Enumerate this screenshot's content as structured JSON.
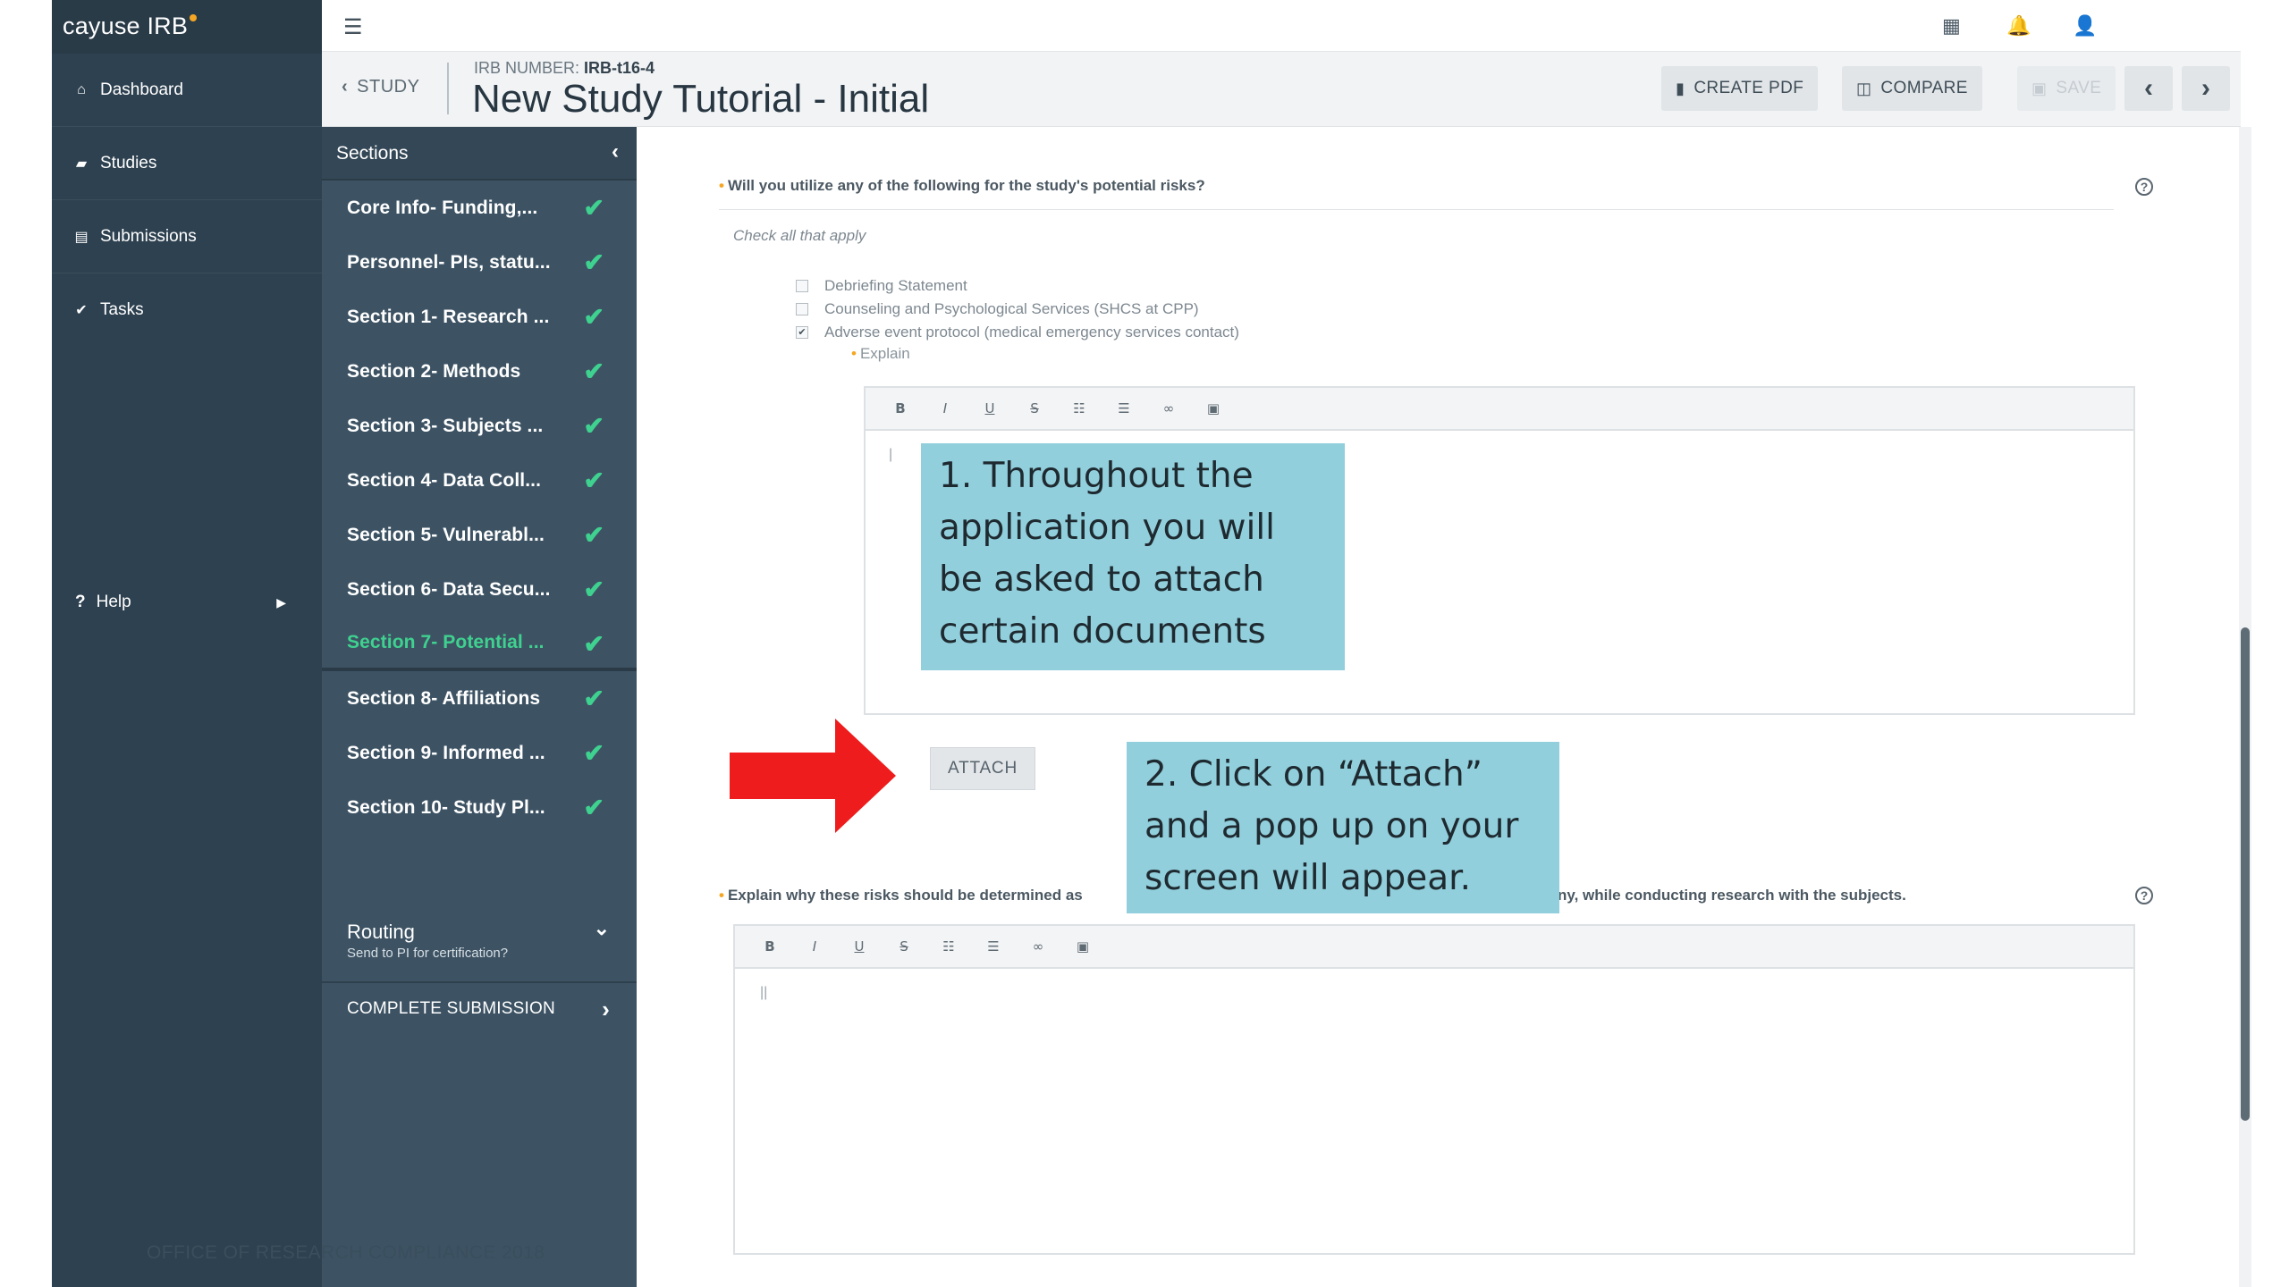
{
  "app": {
    "brand": "cayuse IRB"
  },
  "leftnav": {
    "items": [
      {
        "label": "Dashboard",
        "icon": "home-icon"
      },
      {
        "label": "Studies",
        "icon": "folder-icon"
      },
      {
        "label": "Submissions",
        "icon": "document-icon"
      },
      {
        "label": "Tasks",
        "icon": "check-icon"
      }
    ],
    "help": "Help"
  },
  "header": {
    "back_label": "STUDY",
    "irb_label": "IRB NUMBER:",
    "irb_number": "IRB-t16-4",
    "title": "New Study Tutorial - Initial",
    "buttons": {
      "create_pdf": "CREATE PDF",
      "compare": "COMPARE",
      "save": "SAVE"
    }
  },
  "sections": {
    "header": "Sections",
    "items": [
      {
        "label": "Core Info- Funding,...",
        "complete": true
      },
      {
        "label": "Personnel- PIs, statu...",
        "complete": true
      },
      {
        "label": "Section 1- Research ...",
        "complete": true
      },
      {
        "label": "Section 2- Methods",
        "complete": true
      },
      {
        "label": "Section 3- Subjects ...",
        "complete": true
      },
      {
        "label": "Section 4- Data Coll...",
        "complete": true
      },
      {
        "label": "Section 5- Vulnerabl...",
        "complete": true
      },
      {
        "label": "Section 6- Data Secu...",
        "complete": true
      },
      {
        "label": "Section 7- Potential ...",
        "complete": true,
        "active": true
      },
      {
        "label": "Section 8- Affiliations",
        "complete": true
      },
      {
        "label": "Section 9- Informed ...",
        "complete": true
      },
      {
        "label": "Section 10- Study Pl...",
        "complete": true
      }
    ],
    "routing_title": "Routing",
    "routing_sub": "Send to PI for certification?",
    "complete_submission": "COMPLETE SUBMISSION"
  },
  "main": {
    "question1": "Will you utilize any of the following for the study's potential risks?",
    "check_all": "Check all that apply",
    "options": [
      {
        "label": "Debriefing Statement",
        "checked": false
      },
      {
        "label": "Counseling and Psychological Services (SHCS at CPP)",
        "checked": false
      },
      {
        "label": "Adverse event protocol (medical emergency services contact)",
        "checked": true
      }
    ],
    "explain_label": "Explain",
    "toolbar": [
      "B",
      "I",
      "U",
      "S",
      "list-ordered",
      "list-bulleted",
      "link",
      "image"
    ],
    "attach_label": "ATTACH",
    "question2_start": "Explain why these risks should be determined as",
    "question2_end": "ny, while conducting research with the subjects."
  },
  "callouts": {
    "one": "1. Throughout the application you will be asked to attach certain documents",
    "two": "2. Click on “Attach” and a pop up on your screen will appear."
  },
  "footer": "OFFICE OF RESEARCH COMPLIANCE 2018",
  "colors": {
    "nav": "#2e4150",
    "sections": "#3d5364",
    "check": "#3fd18f",
    "callout": "#92cfdc",
    "arrow": "#ee1c1c"
  }
}
